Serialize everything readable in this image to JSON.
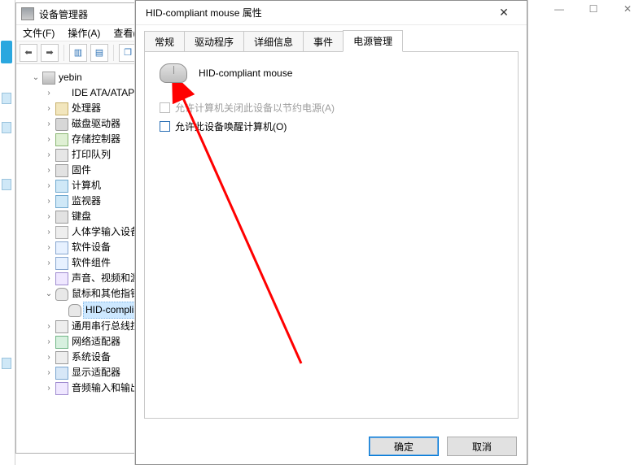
{
  "bg_window": {
    "min": "—",
    "max": "☐",
    "close": "✕"
  },
  "devmgr": {
    "title": "设备管理器",
    "menus": [
      "文件(F)",
      "操作(A)",
      "查看(V"
    ],
    "root": "yebin",
    "nodes": [
      {
        "label": "IDE ATA/ATAPI 控",
        "ic": "ic-disk"
      },
      {
        "label": "处理器",
        "ic": "ic-chip"
      },
      {
        "label": "磁盘驱动器",
        "ic": "ic-hdd"
      },
      {
        "label": "存储控制器",
        "ic": "ic-ctrl"
      },
      {
        "label": "打印队列",
        "ic": "ic-prn"
      },
      {
        "label": "固件",
        "ic": "ic-fw"
      },
      {
        "label": "计算机",
        "ic": "ic-comp"
      },
      {
        "label": "监视器",
        "ic": "ic-mon"
      },
      {
        "label": "键盘",
        "ic": "ic-kbd"
      },
      {
        "label": "人体学输入设备",
        "ic": "ic-hid"
      },
      {
        "label": "软件设备",
        "ic": "ic-sw"
      },
      {
        "label": "软件组件",
        "ic": "ic-swc"
      },
      {
        "label": "声音、视频和游戏",
        "ic": "ic-snd"
      },
      {
        "label": "鼠标和其他指针设",
        "ic": "ic-mouse",
        "expanded": true,
        "children": [
          {
            "label": "HID-complian",
            "ic": "ic-mouse",
            "selected": true
          }
        ]
      },
      {
        "label": "通用串行总线控制",
        "ic": "ic-usb"
      },
      {
        "label": "网络适配器",
        "ic": "ic-net"
      },
      {
        "label": "系统设备",
        "ic": "ic-sys"
      },
      {
        "label": "显示适配器",
        "ic": "ic-disp"
      },
      {
        "label": "音频输入和输出",
        "ic": "ic-aud"
      }
    ]
  },
  "dialog": {
    "title": "HID-compliant mouse 属性",
    "tabs": [
      "常规",
      "驱动程序",
      "详细信息",
      "事件",
      "电源管理"
    ],
    "active_tab_index": 4,
    "device_name": "HID-compliant mouse",
    "opt_power_off": "允许计算机关闭此设备以节约电源(A)",
    "opt_wake": "允许此设备唤醒计算机(O)",
    "ok": "确定",
    "cancel": "取消"
  }
}
